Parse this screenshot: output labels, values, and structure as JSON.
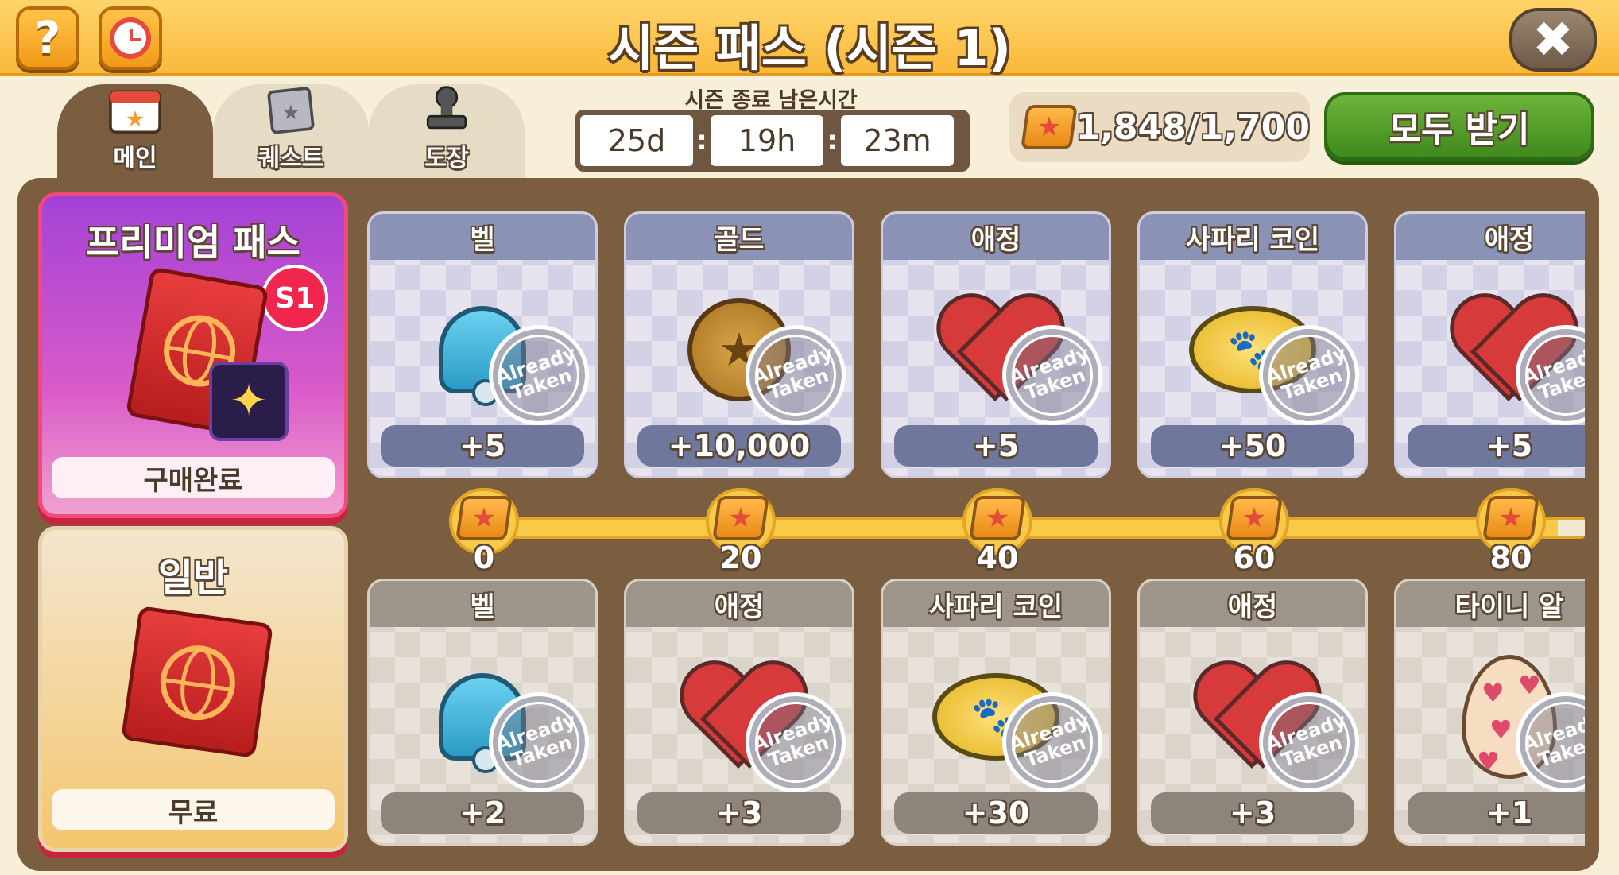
{
  "header": {
    "title": "시즌 패스 (시즌 1)",
    "help_label": "?",
    "close_label": "✖"
  },
  "tabs": [
    {
      "label": "메인",
      "active": true,
      "icon": "calendar-star-icon"
    },
    {
      "label": "퀘스트",
      "active": false,
      "icon": "quest-board-icon"
    },
    {
      "label": "도장",
      "active": false,
      "icon": "stamp-icon"
    }
  ],
  "timer": {
    "caption": "시즌 종료 남은시간",
    "days": "25d",
    "hours": "19h",
    "minutes": "23m",
    "separator": ":"
  },
  "points": {
    "value": "1,848/1,700",
    "icon": "pass-point-icon"
  },
  "claim_all_label": "모두 받기",
  "premium": {
    "title": "프리미엄 패스",
    "badge": "S1",
    "status": "구매완료",
    "sparkle": "✦"
  },
  "normal": {
    "title": "일반",
    "status": "무료"
  },
  "stamp_text": [
    "Already",
    "Taken"
  ],
  "premium_rewards": [
    {
      "name": "벨",
      "amount": "+5",
      "icon": "bell-icon"
    },
    {
      "name": "골드",
      "amount": "+10,000",
      "icon": "gold-coin-icon"
    },
    {
      "name": "애정",
      "amount": "+5",
      "icon": "heart-icon"
    },
    {
      "name": "사파리 코인",
      "amount": "+50",
      "icon": "safari-coin-icon"
    },
    {
      "name": "애정",
      "amount": "+5",
      "icon": "heart-icon"
    }
  ],
  "free_rewards": [
    {
      "name": "벨",
      "amount": "+2",
      "icon": "bell-icon"
    },
    {
      "name": "애정",
      "amount": "+3",
      "icon": "heart-icon"
    },
    {
      "name": "사파리 코인",
      "amount": "+30",
      "icon": "safari-coin-icon"
    },
    {
      "name": "애정",
      "amount": "+3",
      "icon": "heart-icon"
    },
    {
      "name": "타이니 알",
      "amount": "+1",
      "icon": "egg-icon"
    }
  ],
  "milestones": [
    "0",
    "20",
    "40",
    "60",
    "80"
  ],
  "colors": {
    "title_bar": "#f9b93b",
    "claim_button": "#3e8a1c",
    "board": "#7b5d3f",
    "premium_border": "#f0497a"
  }
}
